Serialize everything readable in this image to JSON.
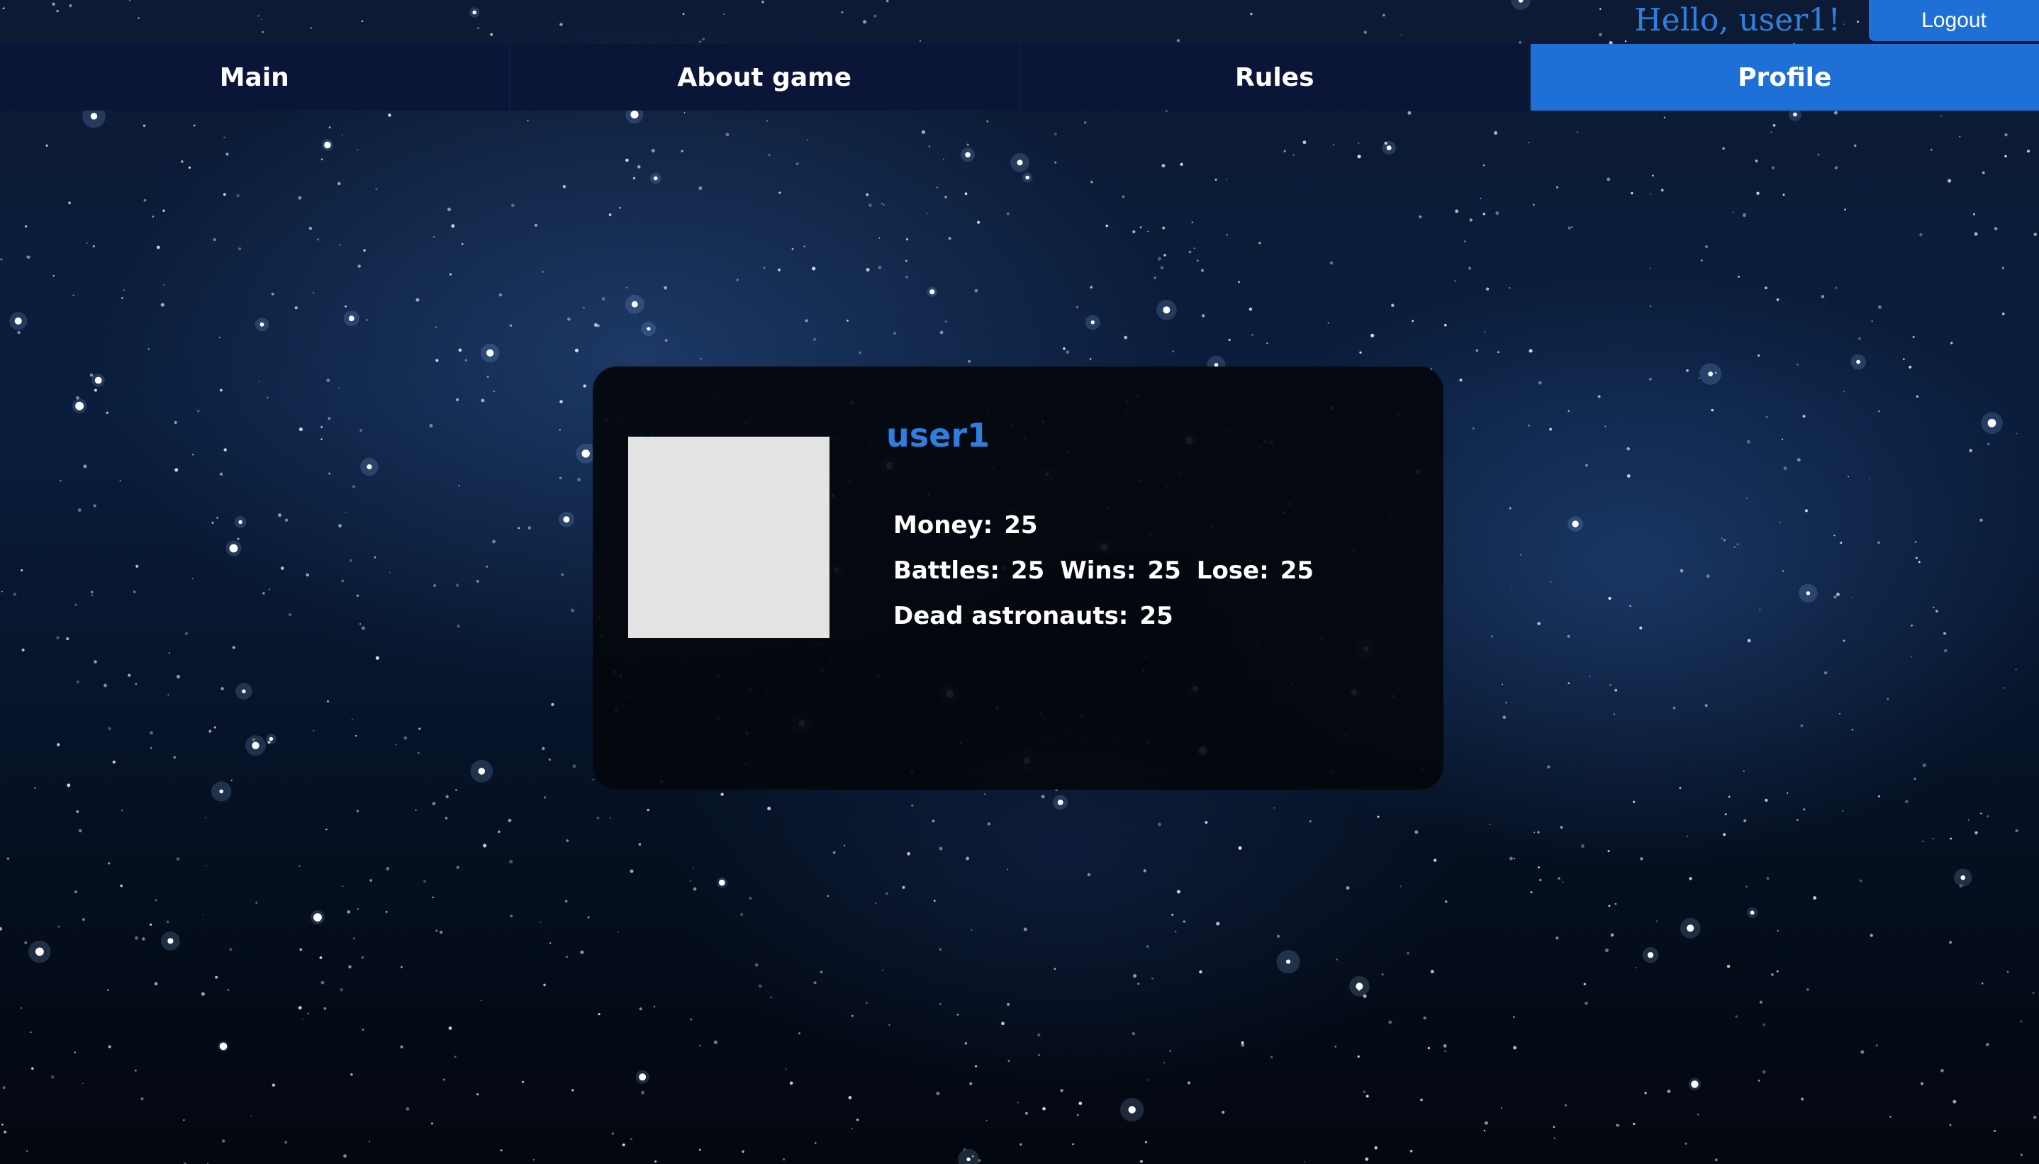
{
  "header": {
    "greeting": "Hello, user1!",
    "logout_label": "Logout"
  },
  "nav": {
    "tabs": [
      {
        "label": "Main",
        "active": false
      },
      {
        "label": "About game",
        "active": false
      },
      {
        "label": "Rules",
        "active": false
      },
      {
        "label": "Profile",
        "active": true
      }
    ]
  },
  "profile": {
    "username": "user1",
    "money_label": "Money:",
    "money": "25",
    "battles_label": "Battles:",
    "battles": "25",
    "wins_label": "Wins:",
    "wins": "25",
    "lose_label": "Lose:",
    "lose": "25",
    "dead_astronauts_label": "Dead astronauts:",
    "dead_astronauts": "25"
  },
  "colors": {
    "accent": "#1f70d6",
    "nav_background": "#0b1538",
    "card_background": "#04070c",
    "avatar_placeholder": "#e3e3e3"
  }
}
